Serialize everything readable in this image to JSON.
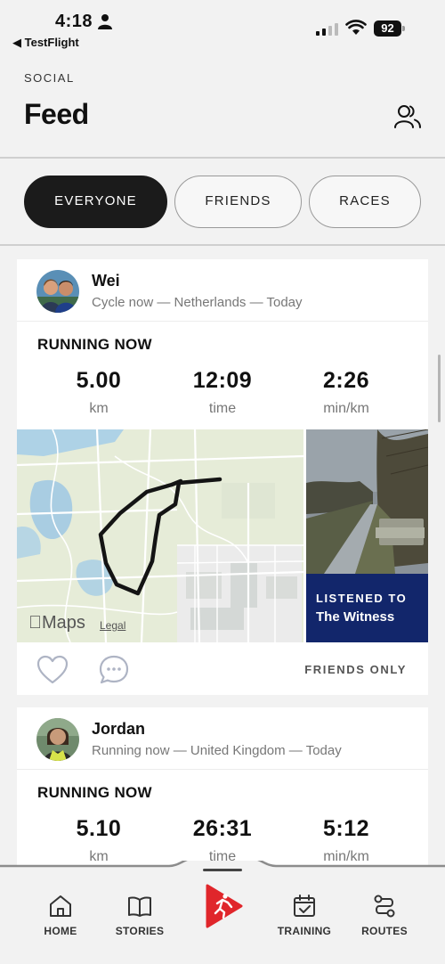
{
  "status": {
    "time": "4:18",
    "back_app": "◀ TestFlight",
    "battery": "92"
  },
  "header": {
    "section": "SOCIAL",
    "title": "Feed"
  },
  "tabs": [
    {
      "label": "EVERYONE",
      "active": true
    },
    {
      "label": "FRIENDS",
      "active": false
    },
    {
      "label": "RACES",
      "active": false
    }
  ],
  "feed": [
    {
      "user": "Wei",
      "meta": "Cycle now — Netherlands — Today",
      "activity": "RUNNING NOW",
      "stats": [
        {
          "value": "5.00",
          "unit": "km"
        },
        {
          "value": "12:09",
          "unit": "time"
        },
        {
          "value": "2:26",
          "unit": "min/km"
        }
      ],
      "map": {
        "logo": "Maps",
        "legal": "Legal"
      },
      "media": {
        "kicker": "LISTENED TO",
        "title": "The Witness"
      },
      "privacy": "FRIENDS ONLY"
    },
    {
      "user": "Jordan",
      "meta": "Running now — United Kingdom — Today",
      "activity": "RUNNING NOW",
      "stats": [
        {
          "value": "5.10",
          "unit": "km"
        },
        {
          "value": "26:31",
          "unit": "time"
        },
        {
          "value": "5:12",
          "unit": "min/km"
        }
      ]
    }
  ],
  "nav": [
    {
      "label": "HOME",
      "icon": "home-icon"
    },
    {
      "label": "STORIES",
      "icon": "book-icon"
    },
    {
      "label": "TRAINING",
      "icon": "calendar-check-icon"
    },
    {
      "label": "ROUTES",
      "icon": "route-icon"
    }
  ],
  "colors": {
    "accent": "#e0262b",
    "media_label": "#12266b",
    "active_tab": "#1b1b1b"
  }
}
